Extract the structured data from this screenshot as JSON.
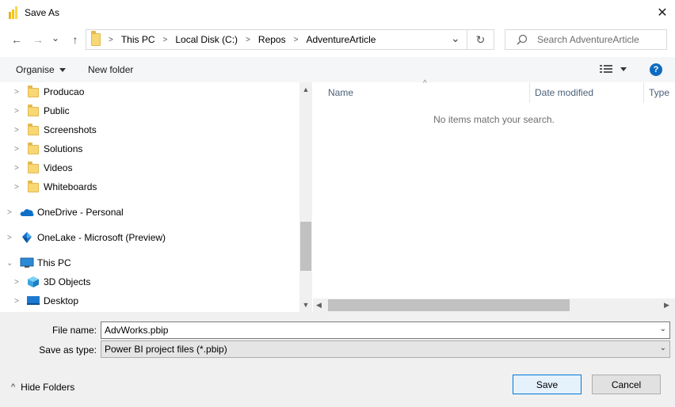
{
  "window": {
    "title": "Save As",
    "close_glyph": "✕"
  },
  "nav": {
    "back_glyph": "←",
    "forward_glyph": "→",
    "recent_glyph": "⌄",
    "up_glyph": "↑"
  },
  "address": {
    "crumbs": [
      "This PC",
      "Local Disk (C:)",
      "Repos",
      "AdventureArticle"
    ],
    "dropdown_glyph": "⌄",
    "refresh_glyph": "↻"
  },
  "search": {
    "placeholder": "Search AdventureArticle"
  },
  "toolbar": {
    "organise_label": "Organise",
    "new_folder_label": "New folder",
    "help_glyph": "?"
  },
  "tree": {
    "folders": [
      "Producao",
      "Public",
      "Screenshots",
      "Solutions",
      "Videos",
      "Whiteboards"
    ],
    "onedrive": "OneDrive - Personal",
    "onelake": "OneLake - Microsoft (Preview)",
    "thispc": "This PC",
    "thispc_children": [
      "3D Objects",
      "Desktop"
    ]
  },
  "columns": {
    "name": "Name",
    "date_modified": "Date modified",
    "type": "Type"
  },
  "empty_message": "No items match your search.",
  "form": {
    "file_name_label": "File name:",
    "file_name_value": "AdvWorks.pbip",
    "save_type_label": "Save as type:",
    "save_type_value": "Power BI project files (*.pbip)"
  },
  "footer": {
    "hide_folders_label": "Hide Folders",
    "save_label": "Save",
    "cancel_label": "Cancel"
  },
  "colors": {
    "accent": "#0078d7",
    "folder": "#f8d775",
    "help": "#0e6cc0"
  }
}
